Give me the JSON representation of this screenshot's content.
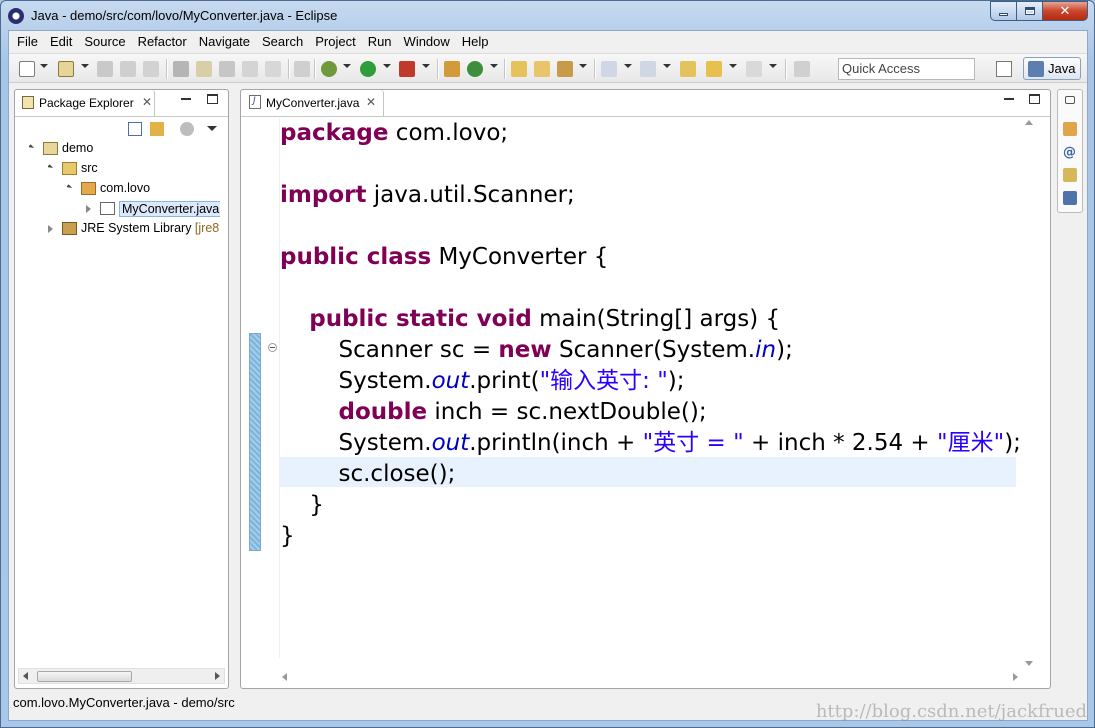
{
  "window": {
    "title": "Java - demo/src/com/lovo/MyConverter.java - Eclipse"
  },
  "menu": [
    "File",
    "Edit",
    "Source",
    "Refactor",
    "Navigate",
    "Search",
    "Project",
    "Run",
    "Window",
    "Help"
  ],
  "toolbar": {
    "quick_access_placeholder": "Quick Access",
    "perspective": "Java"
  },
  "package_explorer": {
    "tab_label": "Package Explorer",
    "tree": [
      {
        "label": "demo",
        "icon": "project-icon",
        "level": 0,
        "expanded": true
      },
      {
        "label": "src",
        "icon": "source-folder-icon",
        "level": 1,
        "expanded": true
      },
      {
        "label": "com.lovo",
        "icon": "package-icon",
        "level": 2,
        "expanded": true
      },
      {
        "label": "MyConverter.java",
        "icon": "java-file-icon",
        "level": 3,
        "expanded": false,
        "selected": true
      },
      {
        "label": "JRE System Library",
        "suffix": "[jre8",
        "icon": "library-icon",
        "level": 1,
        "expanded": false
      }
    ]
  },
  "editor": {
    "tab_label": "MyConverter.java",
    "code_lines": [
      [
        {
          "t": "package",
          "c": "kw"
        },
        {
          "t": " com.lovo;"
        }
      ],
      [],
      [
        {
          "t": "import",
          "c": "kw"
        },
        {
          "t": " java.util.Scanner;"
        }
      ],
      [],
      [
        {
          "t": "public class",
          "c": "kw"
        },
        {
          "t": " MyConverter {"
        }
      ],
      [],
      [
        {
          "t": "    "
        },
        {
          "t": "public static void",
          "c": "kw"
        },
        {
          "t": " main(String[] args) {"
        }
      ],
      [
        {
          "t": "        Scanner sc = "
        },
        {
          "t": "new",
          "c": "kw"
        },
        {
          "t": " Scanner(System."
        },
        {
          "t": "in",
          "c": "fld"
        },
        {
          "t": ");"
        }
      ],
      [
        {
          "t": "        System."
        },
        {
          "t": "out",
          "c": "fld"
        },
        {
          "t": ".print("
        },
        {
          "t": "\"输入英寸: \"",
          "c": "str"
        },
        {
          "t": ");"
        }
      ],
      [
        {
          "t": "        "
        },
        {
          "t": "double",
          "c": "kw"
        },
        {
          "t": " inch = sc.nextDouble();"
        }
      ],
      [
        {
          "t": "        System."
        },
        {
          "t": "out",
          "c": "fld"
        },
        {
          "t": ".println(inch + "
        },
        {
          "t": "\"英寸 = \"",
          "c": "str"
        },
        {
          "t": " + inch * 2.54 + "
        },
        {
          "t": "\"厘米\"",
          "c": "str"
        },
        {
          "t": ");"
        }
      ],
      [
        {
          "t": "        sc.close();"
        }
      ],
      [
        {
          "t": "    }"
        }
      ],
      [
        {
          "t": "}"
        }
      ]
    ]
  },
  "status": {
    "text": "com.lovo.MyConverter.java - demo/src"
  },
  "watermark": "http://blog.csdn.net/jackfrued",
  "colors": {
    "keyword": "#7f0055",
    "string": "#2a00ff",
    "field": "#0000c0",
    "current_line": "#e8f2fe"
  }
}
